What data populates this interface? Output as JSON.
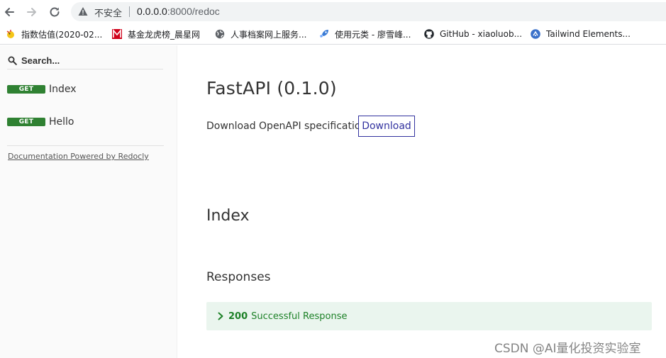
{
  "browser": {
    "insecure_label": "不安全",
    "url_host": "0.0.0.0",
    "url_path": ":8000/redoc",
    "icons": {
      "back": "arrow-left-icon",
      "forward": "arrow-right-icon",
      "reload": "reload-icon",
      "warning": "warning-triangle-icon"
    }
  },
  "bookmarks": [
    {
      "label": "指数估值(2020-02...",
      "icon": "chick-favicon"
    },
    {
      "label": "基金龙虎榜_晨星网",
      "icon": "morningstar-favicon"
    },
    {
      "label": "人事档案网上服务...",
      "icon": "globe-icon"
    },
    {
      "label": "使用元类 - 廖雪峰...",
      "icon": "rocket-icon"
    },
    {
      "label": "GitHub - xiaoluob...",
      "icon": "github-icon"
    },
    {
      "label": "Tailwind Elements...",
      "icon": "tailwind-elements-icon"
    }
  ],
  "sidebar": {
    "search_placeholder": "Search...",
    "items": [
      {
        "method": "GET",
        "label": "Index"
      },
      {
        "method": "GET",
        "label": "Hello"
      }
    ],
    "powered_by": "Documentation Powered by Redocly"
  },
  "main": {
    "title": "FastAPI (0.1.0)",
    "download_text": "Download OpenAPI specification:",
    "download_button": "Download",
    "operation_title": "Index",
    "responses_title": "Responses",
    "response": {
      "code": "200",
      "description": "Successful Response"
    }
  },
  "watermark": "CSDN @AI量化投资实验室",
  "colors": {
    "get_badge": "#2f8132",
    "download_accent": "#32329f",
    "response_bg": "#eaf5ee",
    "response_text": "#1d8127",
    "sidebar_bg": "#fafafa"
  }
}
